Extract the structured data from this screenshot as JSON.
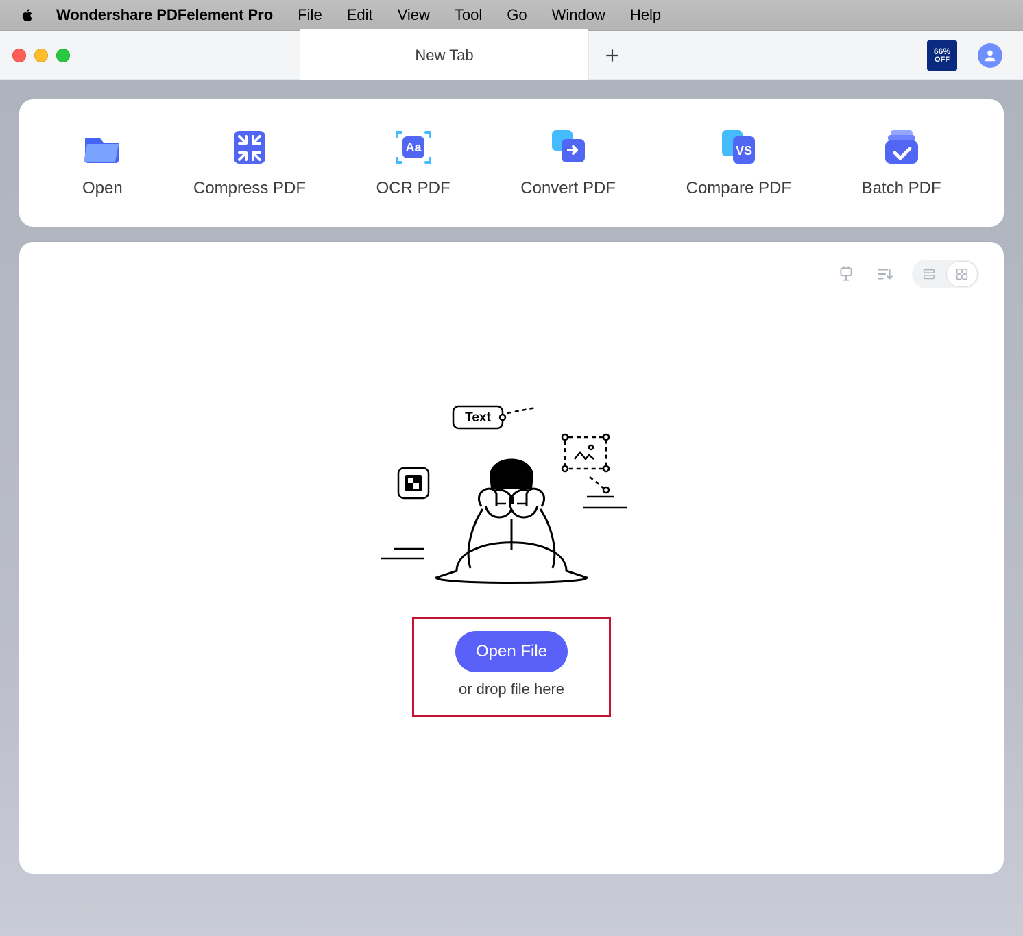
{
  "menubar": {
    "app_title": "Wondershare PDFelement Pro",
    "items": [
      "File",
      "Edit",
      "View",
      "Tool",
      "Go",
      "Window",
      "Help"
    ]
  },
  "tabbar": {
    "tab_title": "New Tab",
    "promo_pct": "66%",
    "promo_off": "OFF"
  },
  "quick_actions": [
    {
      "label": "Open",
      "icon": "folder-open"
    },
    {
      "label": "Compress PDF",
      "icon": "compress"
    },
    {
      "label": "OCR PDF",
      "icon": "ocr"
    },
    {
      "label": "Convert PDF",
      "icon": "convert"
    },
    {
      "label": "Compare PDF",
      "icon": "compare"
    },
    {
      "label": "Batch PDF",
      "icon": "batch"
    }
  ],
  "workspace": {
    "open_file_label": "Open File",
    "drop_hint": "or drop file here",
    "illo_text": "Text"
  },
  "colors": {
    "primary": "#5961f9",
    "accent": "#43bbfe"
  }
}
